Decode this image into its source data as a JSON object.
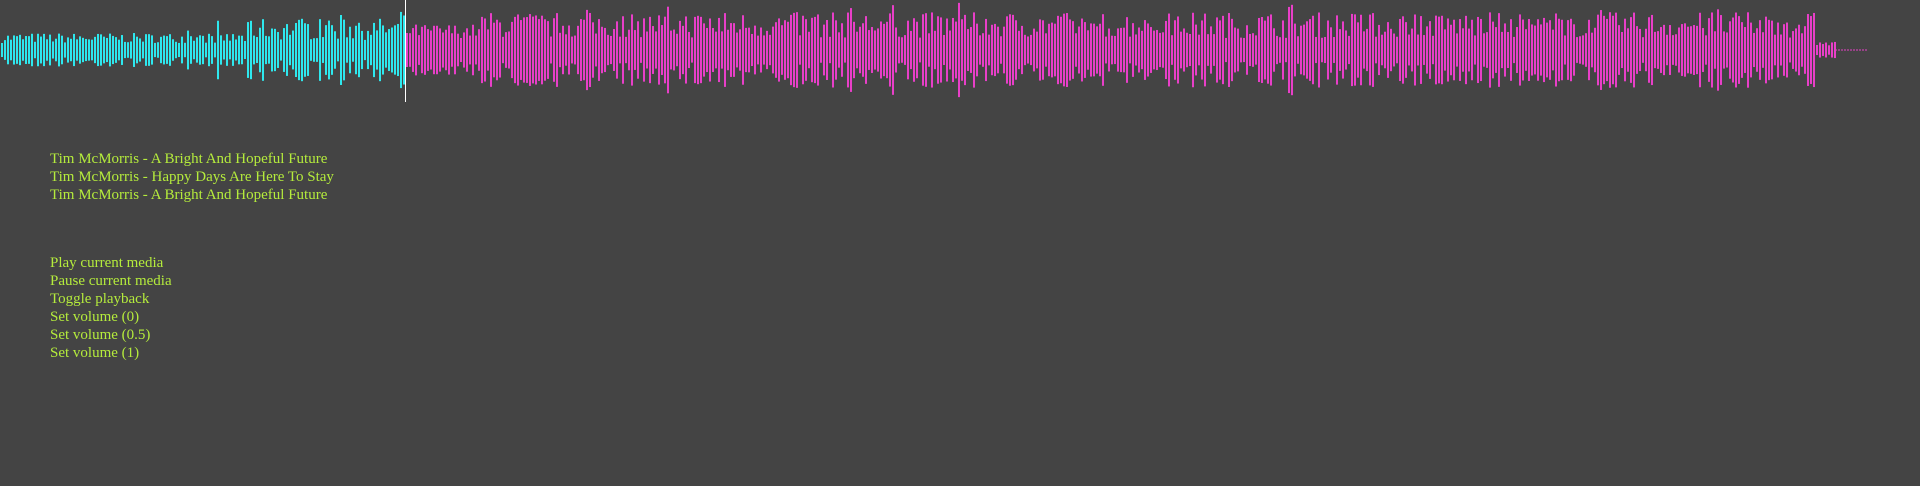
{
  "waveform": {
    "played_color": "#2ee8ee",
    "unplayed_color": "#e83fc8",
    "cursor_color": "#ffffff",
    "progress": 0.22
  },
  "text_color": "#b5ec3c",
  "playlist": {
    "items": [
      {
        "label": "Tim McMorris - A Bright And Hopeful Future"
      },
      {
        "label": "Tim McMorris - Happy Days Are Here To Stay"
      },
      {
        "label": "Tim McMorris - A Bright And Hopeful Future"
      }
    ]
  },
  "controls": {
    "items": [
      {
        "label": "Play current media"
      },
      {
        "label": "Pause current media"
      },
      {
        "label": "Toggle playback"
      },
      {
        "label": "Set volume (0)"
      },
      {
        "label": "Set volume (0.5)"
      },
      {
        "label": "Set volume (1)"
      }
    ]
  }
}
